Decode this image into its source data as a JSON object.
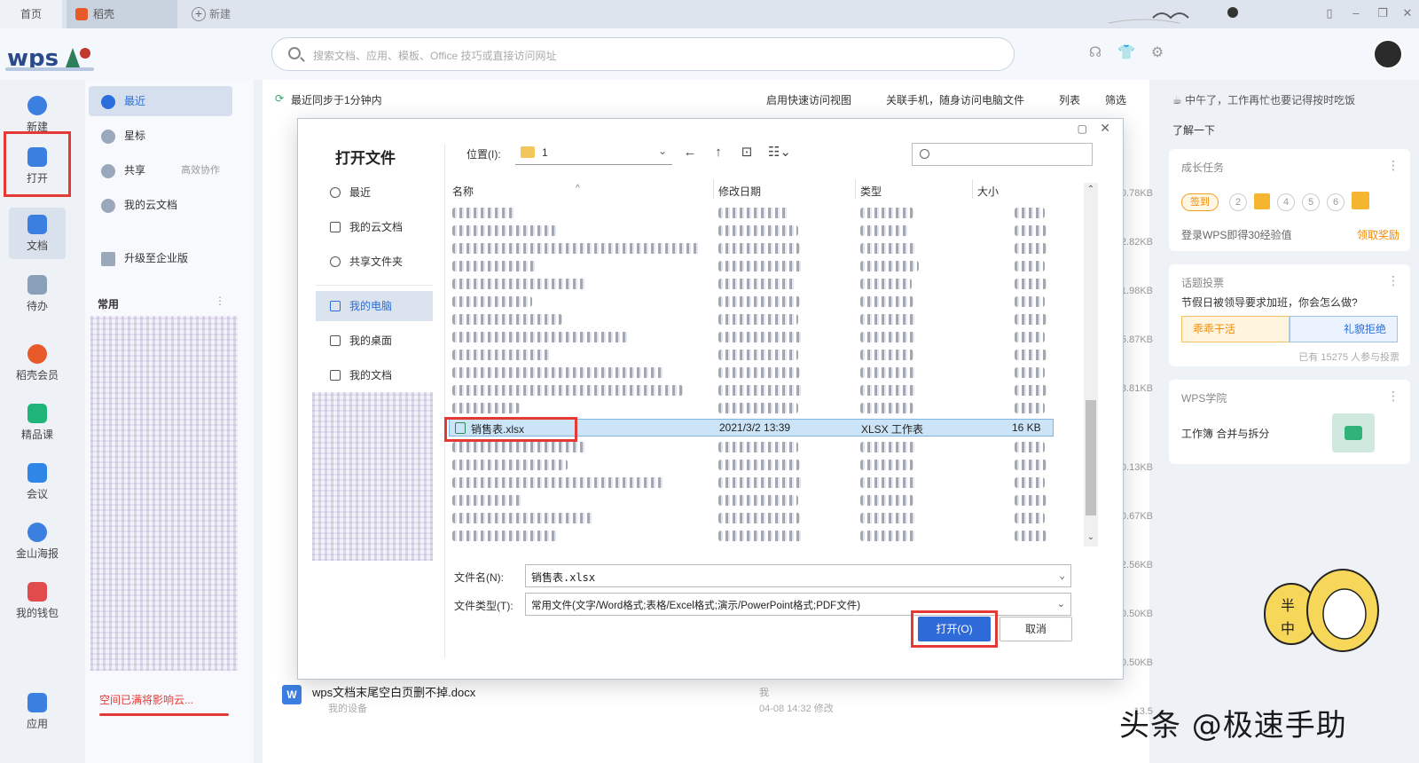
{
  "tabs": {
    "home": "首页",
    "daoke": "稻壳",
    "new": "新建"
  },
  "search": {
    "placeholder": "搜索文档、应用、模板、Office 技巧或直接访问网址"
  },
  "left_nav": [
    {
      "label": "新建",
      "icon": "plus-circle-icon",
      "color": "#3b7fe0"
    },
    {
      "label": "打开",
      "icon": "folder-icon",
      "color": "#3b7fe0"
    },
    {
      "label": "文档",
      "icon": "document-icon",
      "color": "#3b7fe0"
    },
    {
      "label": "待办",
      "icon": "check-icon",
      "color": "#8aa0b8"
    },
    {
      "label": "稻壳会员",
      "icon": "daoke-icon",
      "color": "#e85a2a"
    },
    {
      "label": "精品课",
      "icon": "course-icon",
      "color": "#1fb57a"
    },
    {
      "label": "会议",
      "icon": "meeting-icon",
      "color": "#2f86e6"
    },
    {
      "label": "金山海报",
      "icon": "poster-icon",
      "color": "#3b7fe0"
    },
    {
      "label": "我的钱包",
      "icon": "wallet-icon",
      "color": "#e14b4b"
    },
    {
      "label": "应用",
      "icon": "apps-icon",
      "color": "#3b7fe0"
    }
  ],
  "col2": {
    "items": [
      {
        "label": "最近",
        "icon": "clock-icon"
      },
      {
        "label": "星标",
        "icon": "star-icon"
      },
      {
        "label": "共享",
        "icon": "share-icon",
        "sub": "高效协作"
      },
      {
        "label": "我的云文档",
        "icon": "cloud-doc-icon"
      },
      {
        "label": "升级至企业版",
        "icon": "enterprise-icon"
      }
    ],
    "common_label": "常用",
    "space_warning": "空间已满将影响云..."
  },
  "main": {
    "sync_status": "最近同步于1分钟内",
    "quick_view": "启用快速访问视图",
    "link_phone": "关联手机，随身访问电脑文件",
    "list_label": "列表",
    "filter_label": "筛选",
    "sizes": [
      "0.78KB",
      "2.82KB",
      "1.98KB",
      "5.87KB",
      "8.81KB",
      "0.13KB",
      "0.67KB",
      "2.56KB",
      "0.50KB",
      "0.50KB"
    ],
    "last_file": {
      "name": "wps文档末尾空白页删不掉.docx",
      "location": "我的设备",
      "owner": "我",
      "time": "04-08 14:32 修改",
      "size": "13.5"
    }
  },
  "right": {
    "notice": "中午了，工作再忙也要记得按时吃饭",
    "learn_more": "了解一下",
    "growth": {
      "title": "成长任务",
      "sign": "签到",
      "steps": [
        "2",
        "4",
        "5",
        "6"
      ],
      "login_text": "登录WPS即得30经验值",
      "claim": "领取奖励"
    },
    "topic": {
      "title": "话题投票",
      "question": "节假日被领导要求加班，你会怎么做?",
      "opt_a": "乖乖干活",
      "opt_b": "礼貌拒绝",
      "participants": "已有 15275 人参与投票"
    },
    "academy": {
      "title": "WPS学院",
      "item": "工作簿 合并与拆分"
    }
  },
  "dialog": {
    "title": "打开文件",
    "sidebar": [
      {
        "label": "最近"
      },
      {
        "label": "我的云文档"
      },
      {
        "label": "共享文件夹"
      },
      {
        "label": "我的电脑"
      },
      {
        "label": "我的桌面"
      },
      {
        "label": "我的文档"
      }
    ],
    "location_label": "位置(I):",
    "location_value": "1",
    "columns": {
      "name": "名称",
      "modified": "修改日期",
      "type": "类型",
      "size": "大小"
    },
    "selected_file": {
      "name": "销售表.xlsx",
      "modified": "2021/3/2 13:39",
      "type": "XLSX 工作表",
      "size": "16 KB"
    },
    "filename_label": "文件名(N):",
    "filename_value": "销售表.xlsx",
    "filetype_label": "文件类型(T):",
    "filetype_value": "常用文件(文字/Word格式;表格/Excel格式;演示/PowerPoint格式;PDF文件)",
    "open_button": "打开(O)",
    "cancel_button": "取消"
  },
  "watermark": "头条 @极速手助",
  "colors": {
    "accent": "#2f6bd8",
    "highlight_red": "#e53935",
    "selected_row": "#cce4f7"
  }
}
